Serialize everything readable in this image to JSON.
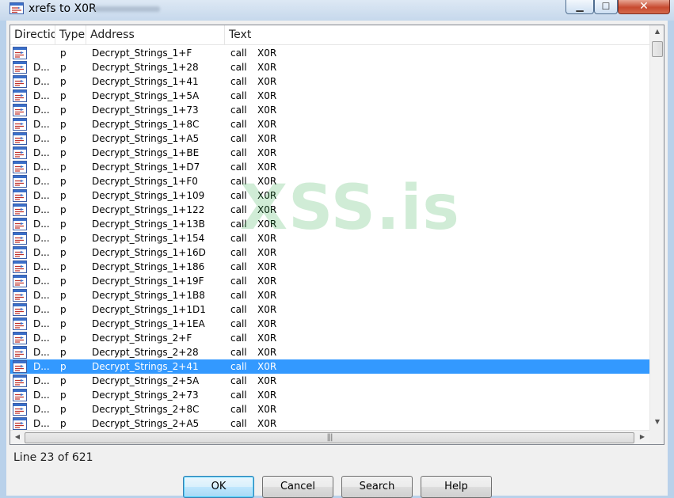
{
  "window": {
    "title": "xrefs to X0R",
    "minimize_glyph": "▁",
    "maximize_glyph": "☐",
    "close_glyph": "✕"
  },
  "columns": [
    "Directio",
    "Type",
    "Address",
    "Text"
  ],
  "rows": [
    {
      "direction": "",
      "type": "p",
      "address": "Decrypt_Strings_1+F",
      "op": "call",
      "operand": "X0R"
    },
    {
      "direction": "D...",
      "type": "p",
      "address": "Decrypt_Strings_1+28",
      "op": "call",
      "operand": "X0R"
    },
    {
      "direction": "D...",
      "type": "p",
      "address": "Decrypt_Strings_1+41",
      "op": "call",
      "operand": "X0R"
    },
    {
      "direction": "D...",
      "type": "p",
      "address": "Decrypt_Strings_1+5A",
      "op": "call",
      "operand": "X0R"
    },
    {
      "direction": "D...",
      "type": "p",
      "address": "Decrypt_Strings_1+73",
      "op": "call",
      "operand": "X0R"
    },
    {
      "direction": "D...",
      "type": "p",
      "address": "Decrypt_Strings_1+8C",
      "op": "call",
      "operand": "X0R"
    },
    {
      "direction": "D...",
      "type": "p",
      "address": "Decrypt_Strings_1+A5",
      "op": "call",
      "operand": "X0R"
    },
    {
      "direction": "D...",
      "type": "p",
      "address": "Decrypt_Strings_1+BE",
      "op": "call",
      "operand": "X0R"
    },
    {
      "direction": "D...",
      "type": "p",
      "address": "Decrypt_Strings_1+D7",
      "op": "call",
      "operand": "X0R"
    },
    {
      "direction": "D...",
      "type": "p",
      "address": "Decrypt_Strings_1+F0",
      "op": "call",
      "operand": "X0R"
    },
    {
      "direction": "D...",
      "type": "p",
      "address": "Decrypt_Strings_1+109",
      "op": "call",
      "operand": "X0R"
    },
    {
      "direction": "D...",
      "type": "p",
      "address": "Decrypt_Strings_1+122",
      "op": "call",
      "operand": "X0R"
    },
    {
      "direction": "D...",
      "type": "p",
      "address": "Decrypt_Strings_1+13B",
      "op": "call",
      "operand": "X0R"
    },
    {
      "direction": "D...",
      "type": "p",
      "address": "Decrypt_Strings_1+154",
      "op": "call",
      "operand": "X0R"
    },
    {
      "direction": "D...",
      "type": "p",
      "address": "Decrypt_Strings_1+16D",
      "op": "call",
      "operand": "X0R"
    },
    {
      "direction": "D...",
      "type": "p",
      "address": "Decrypt_Strings_1+186",
      "op": "call",
      "operand": "X0R"
    },
    {
      "direction": "D...",
      "type": "p",
      "address": "Decrypt_Strings_1+19F",
      "op": "call",
      "operand": "X0R"
    },
    {
      "direction": "D...",
      "type": "p",
      "address": "Decrypt_Strings_1+1B8",
      "op": "call",
      "operand": "X0R"
    },
    {
      "direction": "D...",
      "type": "p",
      "address": "Decrypt_Strings_1+1D1",
      "op": "call",
      "operand": "X0R"
    },
    {
      "direction": "D...",
      "type": "p",
      "address": "Decrypt_Strings_1+1EA",
      "op": "call",
      "operand": "X0R"
    },
    {
      "direction": "D...",
      "type": "p",
      "address": "Decrypt_Strings_2+F",
      "op": "call",
      "operand": "X0R"
    },
    {
      "direction": "D...",
      "type": "p",
      "address": "Decrypt_Strings_2+28",
      "op": "call",
      "operand": "X0R"
    },
    {
      "direction": "D...",
      "type": "p",
      "address": "Decrypt_Strings_2+41",
      "op": "call",
      "operand": "X0R",
      "selected": true
    },
    {
      "direction": "D...",
      "type": "p",
      "address": "Decrypt_Strings_2+5A",
      "op": "call",
      "operand": "X0R"
    },
    {
      "direction": "D...",
      "type": "p",
      "address": "Decrypt_Strings_2+73",
      "op": "call",
      "operand": "X0R"
    },
    {
      "direction": "D...",
      "type": "p",
      "address": "Decrypt_Strings_2+8C",
      "op": "call",
      "operand": "X0R"
    },
    {
      "direction": "D...",
      "type": "p",
      "address": "Decrypt_Strings_2+A5",
      "op": "call",
      "operand": "X0R"
    }
  ],
  "status": "Line 23 of 621",
  "buttons": {
    "ok": "OK",
    "cancel": "Cancel",
    "search": "Search",
    "help": "Help"
  },
  "watermark": "XSS.is",
  "scroll_glyphs": {
    "up": "▲",
    "down": "▼",
    "left": "◀",
    "right": "▶",
    "grip": "|||"
  },
  "colors": {
    "selection": "#3399ff",
    "title_bg": "#c6d8ec",
    "watermark": "#28aa46"
  }
}
